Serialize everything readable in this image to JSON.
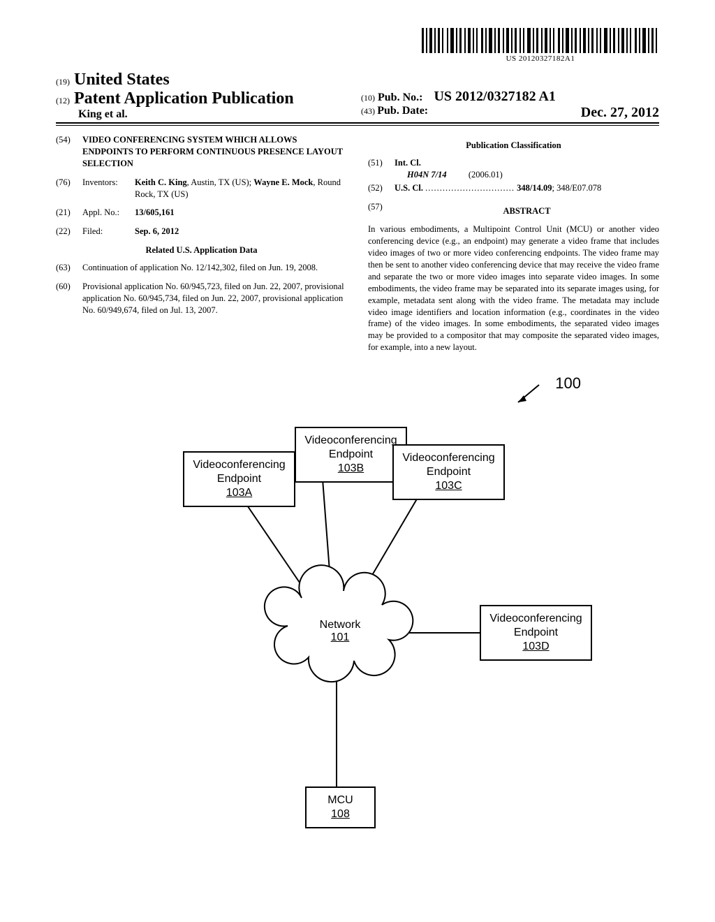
{
  "barcode_number": "US 20120327182A1",
  "header": {
    "country_prefix": "(19)",
    "country": "United States",
    "pub_prefix": "(12)",
    "pub_type": "Patent Application Publication",
    "authors": "King et al.",
    "pubno_prefix": "(10)",
    "pubno_label": "Pub. No.:",
    "pubno_value": "US 2012/0327182 A1",
    "pubdate_prefix": "(43)",
    "pubdate_label": "Pub. Date:",
    "pubdate_value": "Dec. 27, 2012"
  },
  "left": {
    "title_code": "(54)",
    "title": "VIDEO CONFERENCING SYSTEM WHICH ALLOWS ENDPOINTS TO PERFORM CONTINUOUS PRESENCE LAYOUT SELECTION",
    "inventors_code": "(76)",
    "inventors_label": "Inventors:",
    "inventors_value_pre": "Keith C. King",
    "inventors_value_mid": ", Austin, TX (US); ",
    "inventors_value_post": "Wayne E. Mock",
    "inventors_value_end": ", Round Rock, TX (US)",
    "applno_code": "(21)",
    "applno_label": "Appl. No.:",
    "applno_value": "13/605,161",
    "filed_code": "(22)",
    "filed_label": "Filed:",
    "filed_value": "Sep. 6, 2012",
    "related_heading": "Related U.S. Application Data",
    "cont_code": "(63)",
    "cont_text": "Continuation of application No. 12/142,302, filed on Jun. 19, 2008.",
    "prov_code": "(60)",
    "prov_text": "Provisional application No. 60/945,723, filed on Jun. 22, 2007, provisional application No. 60/945,734, filed on Jun. 22, 2007, provisional application No. 60/949,674, filed on Jul. 13, 2007."
  },
  "right": {
    "pubclass_heading": "Publication Classification",
    "intcl_code": "(51)",
    "intcl_label": "Int. Cl.",
    "intcl_class": "H04N 7/14",
    "intcl_date": "(2006.01)",
    "uscl_code": "(52)",
    "uscl_label": "U.S. Cl.",
    "uscl_value_bold": "348/14.09",
    "uscl_value_rest": "; 348/E07.078",
    "abstract_code": "(57)",
    "abstract_heading": "ABSTRACT",
    "abstract_text": "In various embodiments, a Multipoint Control Unit (MCU) or another video conferencing device (e.g., an endpoint) may generate a video frame that includes video images of two or more video conferencing endpoints. The video frame may then be sent to another video conferencing device that may receive the video frame and separate the two or more video images into separate video images. In some embodiments, the video frame may be separated into its separate images using, for example, metadata sent along with the video frame. The metadata may include video image identifiers and location information (e.g., coordinates in the video frame) of the video images. In some embodiments, the separated video images may be provided to a compositor that may composite the separated video images, for example, into a new layout."
  },
  "figure": {
    "ref100": "100",
    "boxA_l1": "Videoconferencing",
    "boxA_l2": "Endpoint",
    "boxA_ref": "103A",
    "boxB_l1": "Videoconferencing",
    "boxB_l2": "Endpoint",
    "boxB_ref": "103B",
    "boxC_l1": "Videoconferencing",
    "boxC_l2": "Endpoint",
    "boxC_ref": "103C",
    "boxD_l1": "Videoconferencing",
    "boxD_l2": "Endpoint",
    "boxD_ref": "103D",
    "net_l1": "Network",
    "net_ref": "101",
    "mcu_l1": "MCU",
    "mcu_ref": "108"
  }
}
